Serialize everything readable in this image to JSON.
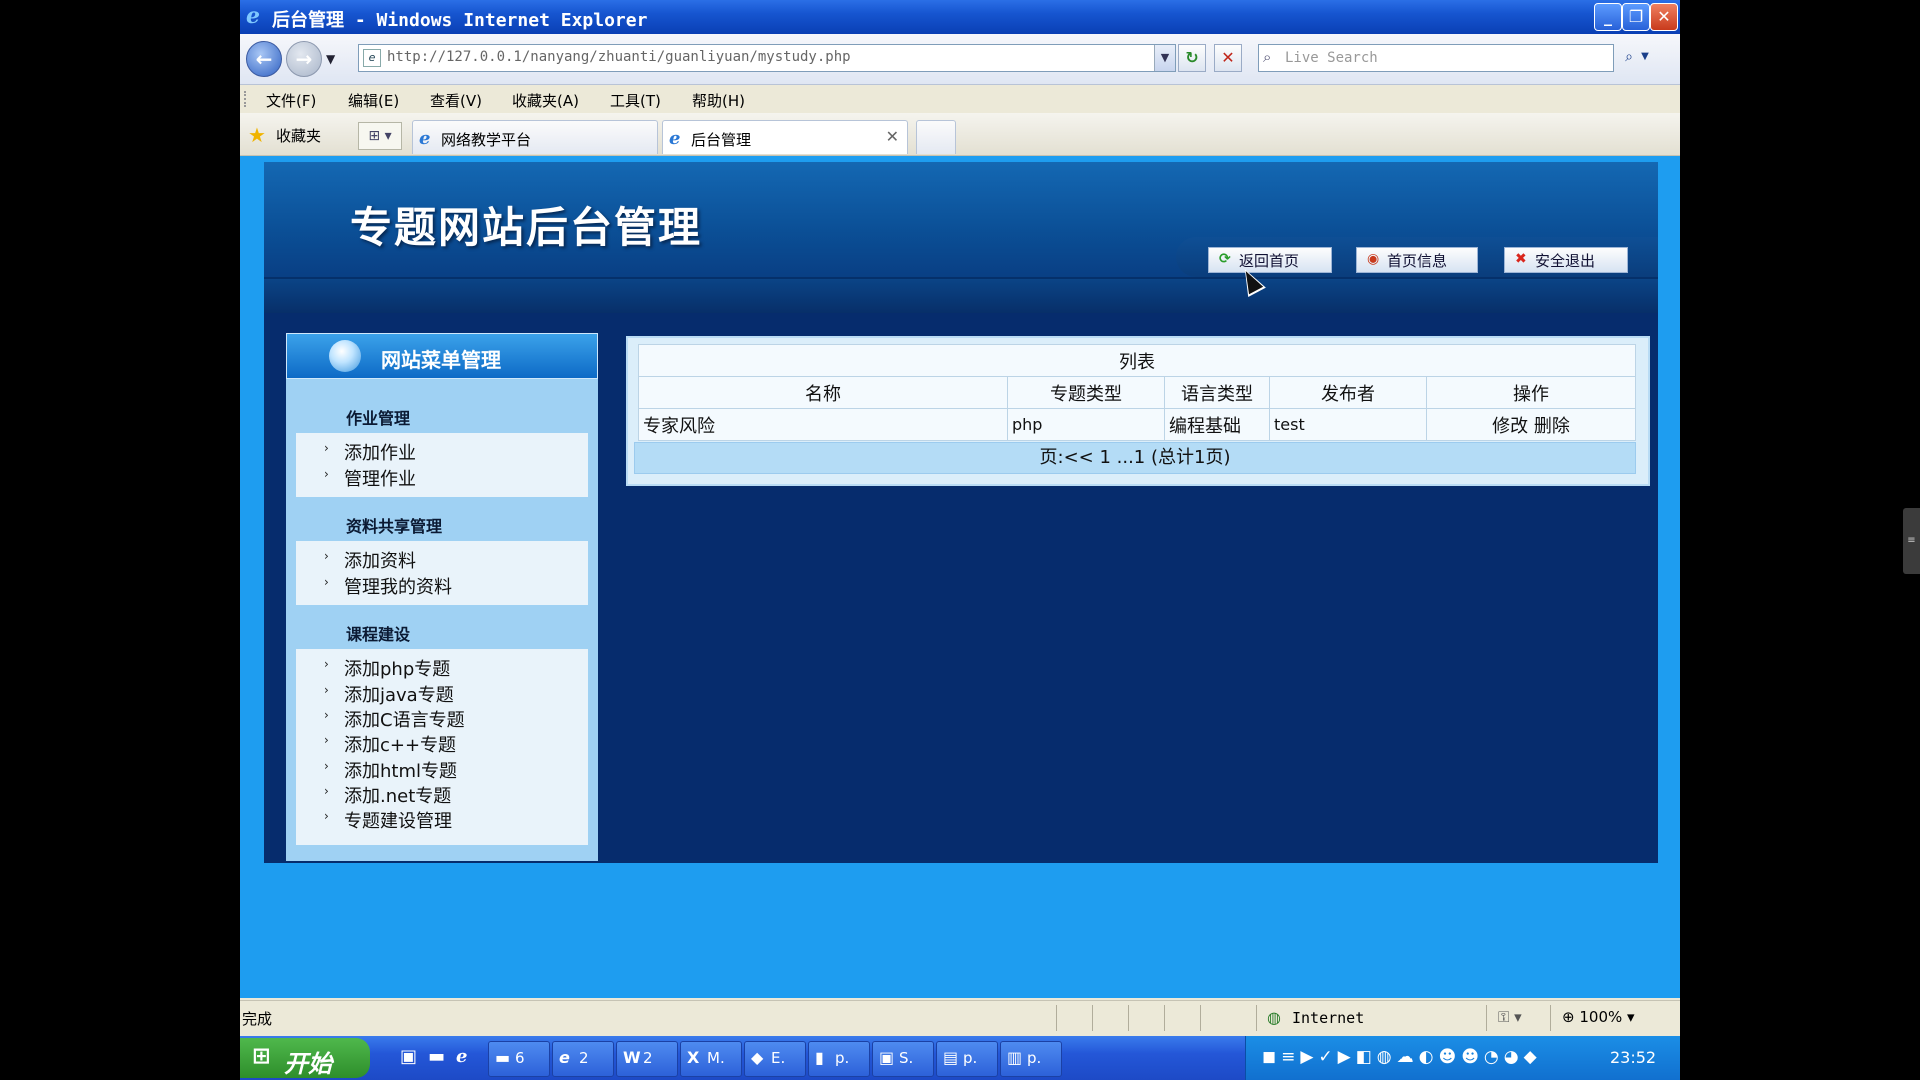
{
  "window": {
    "title": "后台管理 - Windows Internet Explorer"
  },
  "toolbar": {
    "back_glyph": "←",
    "forward_glyph": "→",
    "url": "http://127.0.0.1/nanyang/zhuanti/guanliyuan/mystudy.php",
    "refresh_glyph": "↻",
    "stop_glyph": "✕",
    "search_placeholder": "Live Search"
  },
  "menu": [
    "文件(F)",
    "编辑(E)",
    "查看(V)",
    "收藏夹(A)",
    "工具(T)",
    "帮助(H)"
  ],
  "favorites": {
    "label": "收藏夹",
    "tabs": [
      {
        "label": "网络教学平台"
      },
      {
        "label": "后台管理"
      }
    ]
  },
  "site": {
    "title": "专题网站后台管理",
    "nav": [
      {
        "label": "返回首页",
        "icon": "home-icon",
        "glyph": "⟳",
        "color": "#2a9d2a"
      },
      {
        "label": "首页信息",
        "icon": "info-icon",
        "glyph": "◉",
        "color": "#c83a1c"
      },
      {
        "label": "安全退出",
        "icon": "exit-icon",
        "glyph": "✖",
        "color": "#d9261c"
      }
    ]
  },
  "sidebar": {
    "header": "网站菜单管理",
    "groups": [
      {
        "title": "作业管理",
        "items": [
          "添加作业",
          "管理作业"
        ]
      },
      {
        "title": "资料共享管理",
        "items": [
          "添加资料",
          "管理我的资料"
        ]
      },
      {
        "title": "课程建设",
        "items": [
          "添加php专题",
          "添加java专题",
          "添加C语言专题",
          "添加c++专题",
          "添加html专题",
          "添加.net专题",
          "专题建设管理"
        ]
      }
    ]
  },
  "table": {
    "caption": "列表",
    "headers": [
      "名称",
      "专题类型",
      "语言类型",
      "发布者",
      "操作"
    ],
    "rows": [
      {
        "name": "专家风险",
        "type": "php",
        "lang": "编程基础",
        "author": "test",
        "edit": "修改",
        "delete": "删除"
      }
    ],
    "pager": "页:<< 1 ...1 (总计1页)"
  },
  "status": {
    "text": "完成",
    "zone": "Internet",
    "zoom": "100%"
  },
  "taskbar": {
    "start": "开始",
    "buttons": [
      {
        "icon": "folder-icon",
        "glyph": "▬",
        "label": "6"
      },
      {
        "icon": "ie-icon",
        "glyph": "e",
        "label": "2"
      },
      {
        "icon": "word-icon",
        "glyph": "W",
        "label": "2"
      },
      {
        "icon": "excel-icon",
        "glyph": "X",
        "label": "M."
      },
      {
        "icon": "app-icon",
        "glyph": "◆",
        "label": "E."
      },
      {
        "icon": "app-icon",
        "glyph": "▮",
        "label": "p."
      },
      {
        "icon": "app-icon",
        "glyph": "▣",
        "label": "S."
      },
      {
        "icon": "app-icon",
        "glyph": "▤",
        "label": "p."
      },
      {
        "icon": "app-icon",
        "glyph": "▥",
        "label": "p."
      }
    ],
    "clock": "23:52"
  }
}
